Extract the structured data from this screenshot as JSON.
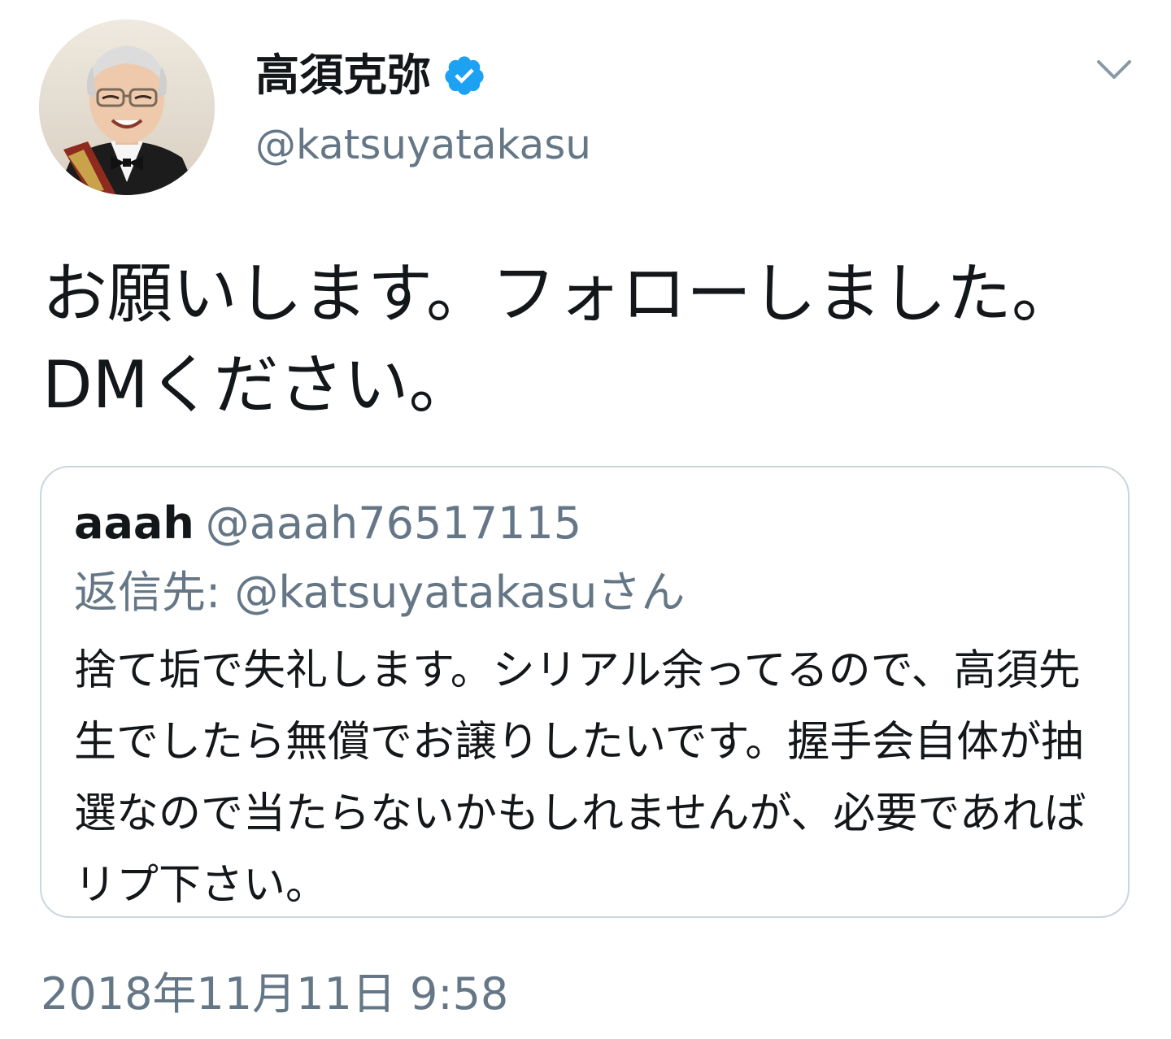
{
  "tweet": {
    "display_name": "高須克弥",
    "handle": "@katsuyatakasu",
    "text": "お願いします。フォローしました。DMください。",
    "timestamp": "2018年11月11日 9:58"
  },
  "quote": {
    "name": "aaah",
    "handle": "@aaah76517115",
    "reply_prefix": "返信先: ",
    "reply_to": "@katsuyatakasu",
    "reply_suffix": "さん",
    "text": "捨て垢で失礼します。シリアル余ってるので、高須先生でしたら無償でお譲りしたいです。握手会自体が抽選なので当たらないかもしれませんが、必要であればリプ下さい。"
  },
  "icons": {
    "verified": "verified-badge-icon",
    "more": "chevron-down-icon"
  },
  "colors": {
    "text_primary": "#14171a",
    "text_secondary": "#657786",
    "verified_blue": "#1da1f2",
    "card_border": "#ccd6dd"
  }
}
